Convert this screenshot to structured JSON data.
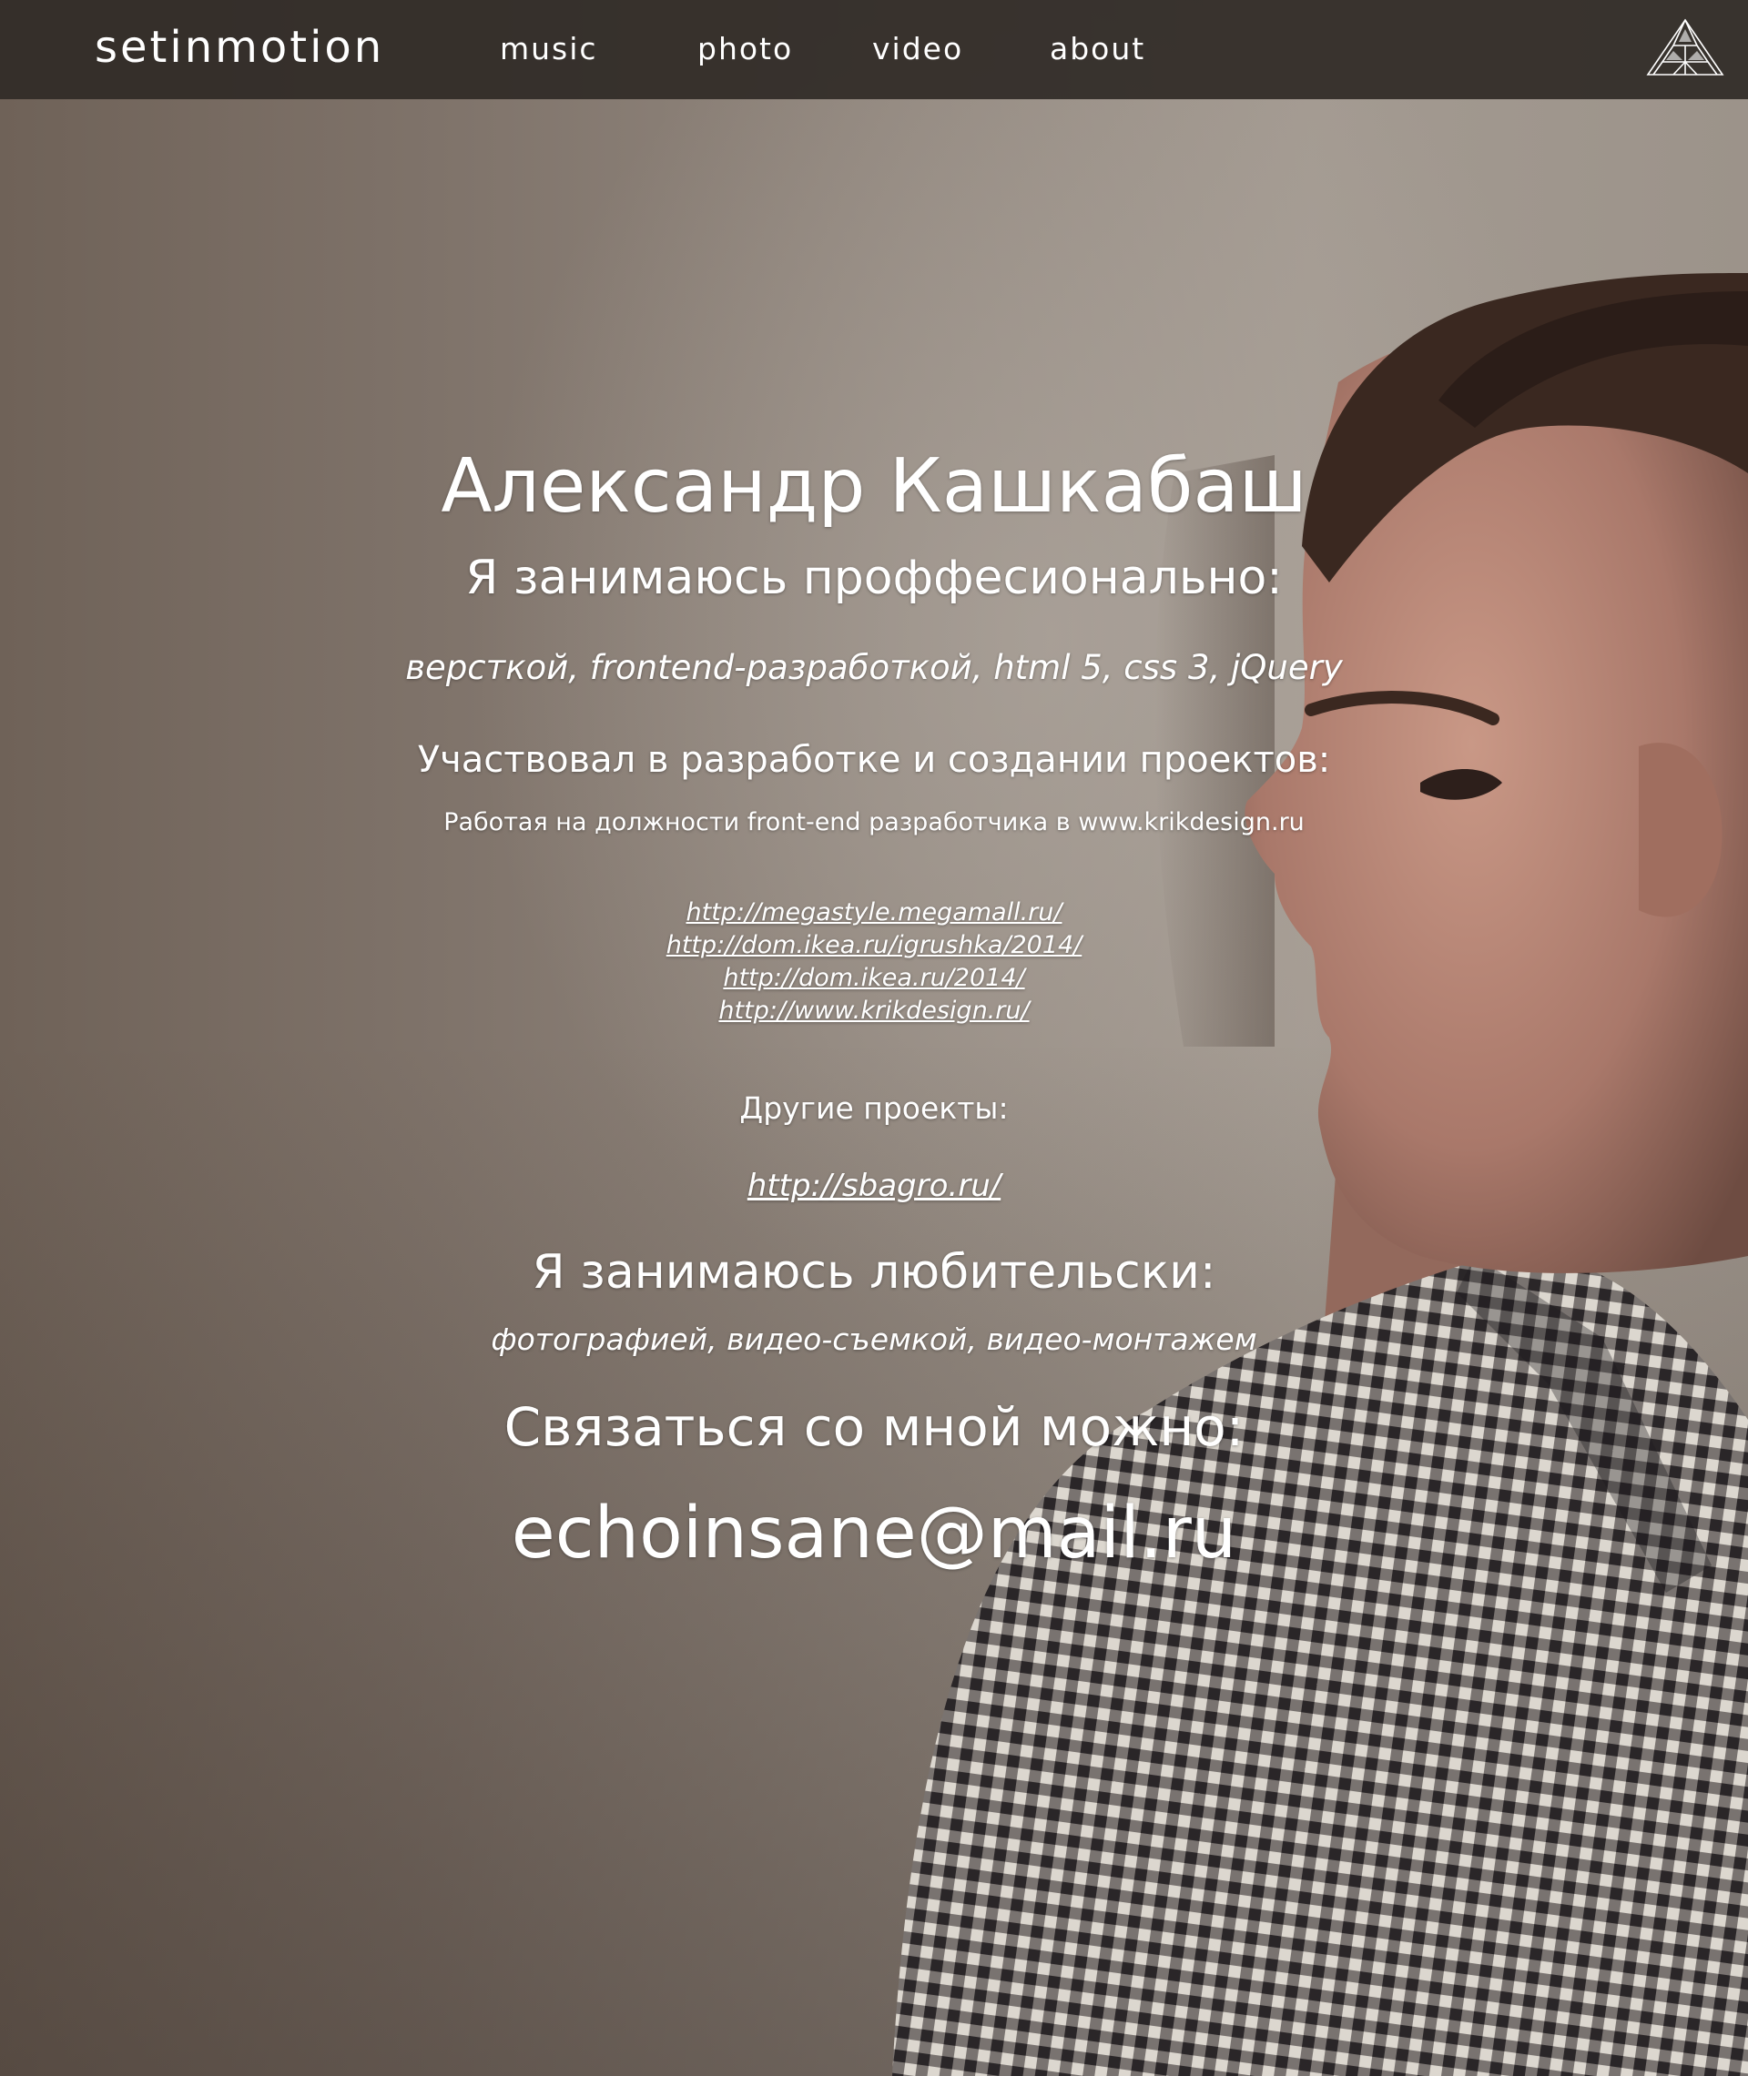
{
  "nav": {
    "logo": "setinmotion",
    "items": [
      "music",
      "photo",
      "video",
      "about"
    ],
    "icon": "tree-icon"
  },
  "profile": {
    "name": "Александр Кашкабаш",
    "professional_heading": "Я занимаюсь проффесионально:",
    "professional_skills": "версткой, frontend-разработкой, html 5, css 3, jQuery",
    "projects_heading": "Участвовал в разработке и создании проектов:",
    "projects_subtitle": "Работая на должности front-end разработчика в www.krikdesign.ru",
    "project_links": [
      "http://megastyle.megamall.ru/",
      "http://dom.ikea.ru/igrushka/2014/",
      "http://dom.ikea.ru/2014/",
      "http://www.krikdesign.ru/"
    ],
    "other_heading": "Другие проекты:",
    "other_link": "http://sbagro.ru/",
    "hobby_heading": "Я занимаюсь любительски:",
    "hobby_list": "фотографией, видео-съемкой, видео-монтажем",
    "contact_heading": "Связаться со мной можно:",
    "email": "echoinsane@mail.ru"
  },
  "colors": {
    "navbar_bg": "#302a26",
    "text": "#ffffff",
    "background": "#8a7f76"
  }
}
